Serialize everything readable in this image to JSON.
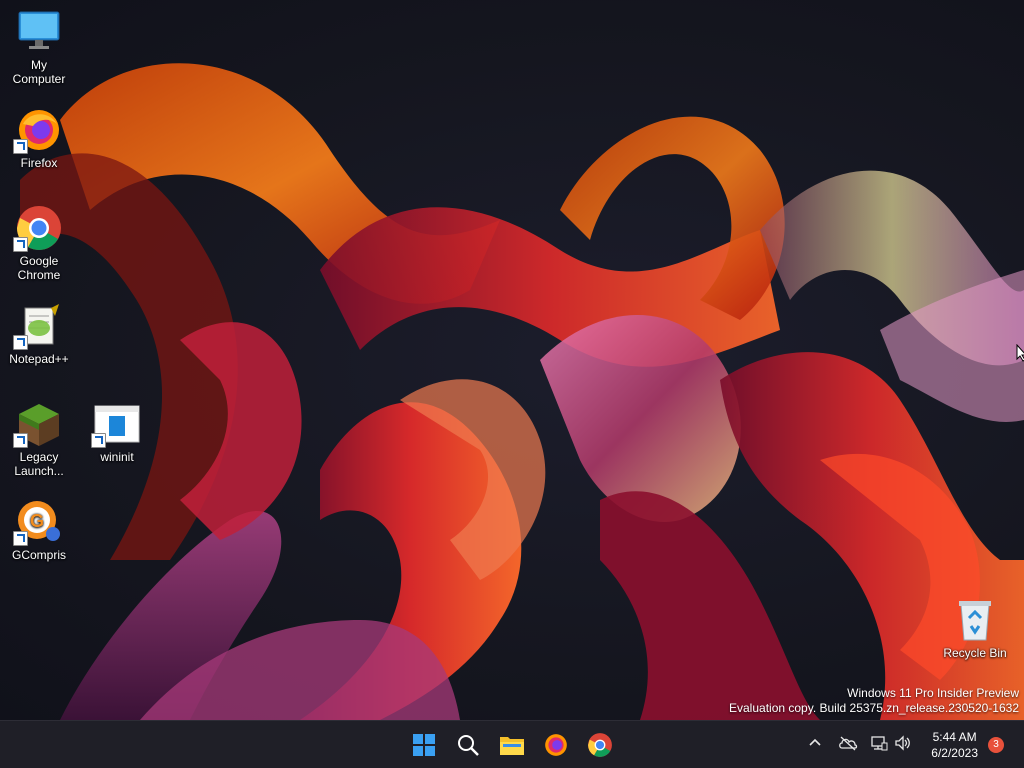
{
  "desktop": {
    "icons": [
      {
        "label": "My Computer",
        "icon": "monitor-icon"
      },
      {
        "label": "Firefox",
        "icon": "firefox-icon"
      },
      {
        "label": "Google Chrome",
        "icon": "chrome-icon"
      },
      {
        "label": "Notepad++",
        "icon": "notepadpp-icon"
      },
      {
        "label": "Legacy Launch...",
        "icon": "minecraft-icon"
      },
      {
        "label": "wininit",
        "icon": "window-icon"
      },
      {
        "label": "GCompris",
        "icon": "gcompris-icon"
      },
      {
        "label": "Recycle Bin",
        "icon": "recycle-bin-icon"
      }
    ],
    "watermark": {
      "line1": "Windows 11 Pro Insider Preview",
      "line2": "Evaluation copy. Build 25375.zn_release.230520-1632"
    }
  },
  "taskbar": {
    "pinned": [
      "start-icon",
      "search-icon",
      "file-explorer-icon",
      "firefox-icon",
      "chrome-icon"
    ],
    "tray": {
      "chevron": "^",
      "time": "5:44 AM",
      "date": "6/2/2023",
      "notifications": "3"
    }
  },
  "colors": {
    "taskbar_bg": "#1f1f27",
    "accent_blue": "#0078d4",
    "notification_badge": "#e8513b"
  }
}
